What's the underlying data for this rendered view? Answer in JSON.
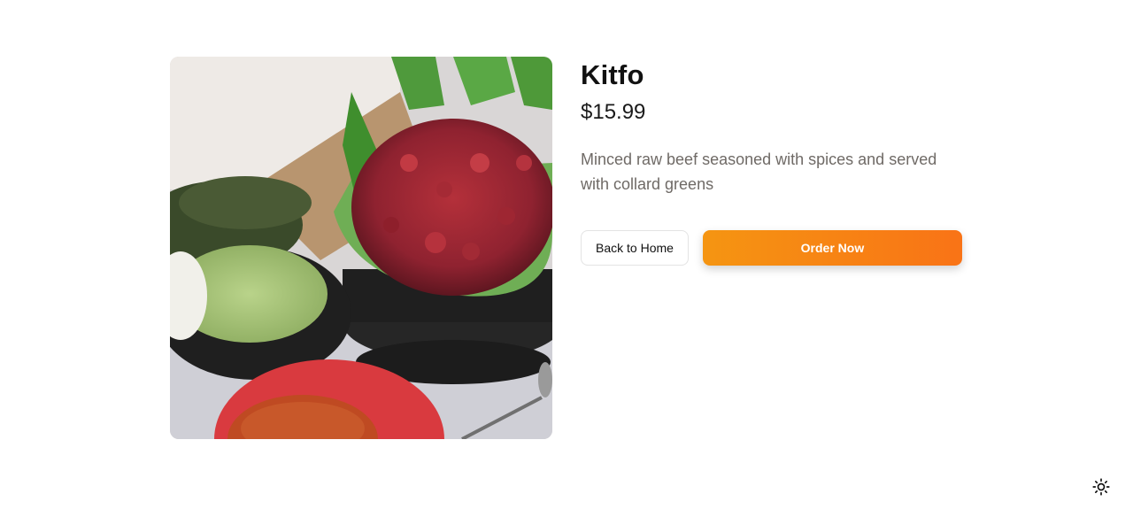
{
  "product": {
    "name": "Kitfo",
    "price": "$15.99",
    "description": "Minced raw beef seasoned with spices and served with collard greens",
    "image_alt": "Kitfo dish"
  },
  "actions": {
    "back_label": "Back to Home",
    "order_label": "Order Now"
  },
  "theme_toggle": {
    "icon": "sun-icon"
  },
  "colors": {
    "accent_start": "#f59512",
    "accent_end": "#f97316",
    "text_primary": "#111111",
    "text_muted": "#6f6a66"
  }
}
